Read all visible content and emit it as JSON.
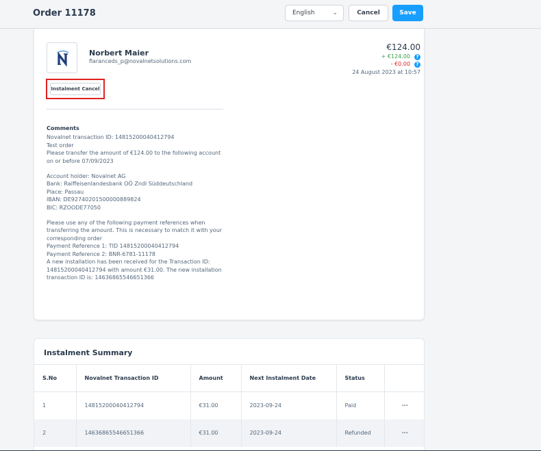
{
  "header": {
    "title": "Order 11178",
    "language": "English",
    "cancel_label": "Cancel",
    "save_label": "Save"
  },
  "customer": {
    "name": "Norbert Maier",
    "email": "flaranceds_p@novalnetsolutions.com",
    "avatar_icon": "novalnet-logo-icon"
  },
  "actions": {
    "instalment_cancel_label": "Instalment Cancel",
    "highlight_color": "#e02020"
  },
  "totals": {
    "total": "€124.00",
    "plus": "+ €124.00",
    "minus": "- €0.00",
    "date": "24 August 2023 at 10:57",
    "plus_color": "#37a34a",
    "minus_color": "#e02020",
    "help_icon": "question-circle-icon"
  },
  "comments": {
    "title": "Comments",
    "block1": "Novalnet transaction ID: 14815200040412794\nTest order\nPlease transfer the amount of €124.00 to the following account\non or before 07/09/2023",
    "block2": "Account holder: Novalnet AG\nBank: Raiffeisenlandesbank OÖ Zndl Süddeutschland\nPlace: Passau\nIBAN: DE92740201500000889824\nBIC: RZOODE77050",
    "block3": "Please use any of the following payment references when\ntransferring the amount. This is necessary to match it with your\ncorresponding order\nPayment Reference 1: TID 14815200040412794\nPayment Reference 2: BNR-6781-11178\nA new installation has been received for the Transaction ID:\n14815200040412794 with amount €31.00. The new installation\ntransaction ID is: 14636865546651366"
  },
  "summary": {
    "title": "Instalment Summary",
    "columns": [
      "S.No",
      "Novalnet Transaction ID",
      "Amount",
      "Next Instalment Date",
      "Status",
      ""
    ],
    "rows": [
      {
        "sno": "1",
        "tid": "14815200040412794",
        "amount": "€31.00",
        "date": "2023-09-24",
        "status": "Paid",
        "menu": "···"
      },
      {
        "sno": "2",
        "tid": "14636865546651366",
        "amount": "€31.00",
        "date": "2023-09-24",
        "status": "Refunded",
        "menu": "···"
      }
    ]
  },
  "colors": {
    "accent": "#189eff",
    "background": "#f4f5f7"
  }
}
